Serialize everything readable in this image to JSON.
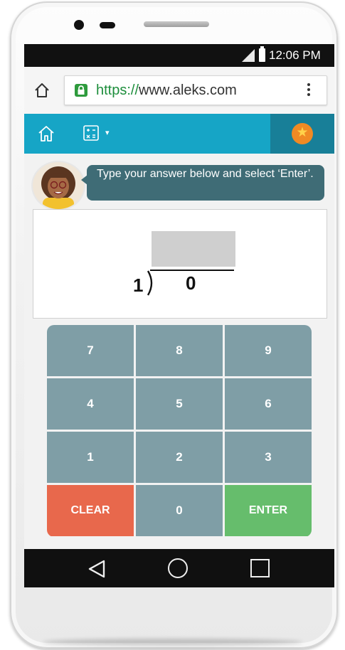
{
  "status_bar": {
    "time": "12:06 PM"
  },
  "browser": {
    "url_scheme": "https://",
    "url_host": "www.aleks.com"
  },
  "app_bar": {
    "home_icon": "home-icon",
    "calculator_icon": "calculator-icon",
    "caret": "▾",
    "star_icon": "star-icon"
  },
  "instruction": {
    "text": "Type your answer below and select ‘Enter’."
  },
  "problem": {
    "divisor": "1",
    "dividend": "0"
  },
  "keypad": {
    "keys": [
      "7",
      "8",
      "9",
      "4",
      "5",
      "6",
      "1",
      "2",
      "3",
      "CLEAR",
      "0",
      "ENTER"
    ]
  },
  "colors": {
    "app_bar": "#16a5c6",
    "app_bar_dark": "#187f98",
    "bubble": "#3f6c76",
    "key": "#7f9ea6",
    "clear": "#e8684c",
    "enter": "#66bd6c"
  }
}
